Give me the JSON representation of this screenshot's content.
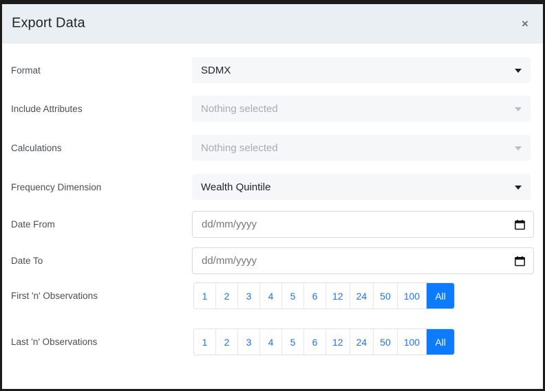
{
  "modal": {
    "title": "Export Data",
    "close_label": "×",
    "close_icon": "close-icon"
  },
  "theme": {
    "accent": "#0d7bfd",
    "link": "#1a73ff",
    "header_bg": "#eaeff3",
    "field_bg": "#f6f7f9",
    "label_color": "#4a4f54",
    "placeholder_color": "#a7acb1",
    "border_color": "#d5d9dd",
    "frame_color": "#1b1b1b"
  },
  "form": {
    "format": {
      "label": "Format",
      "value": "SDMX",
      "disabled": false,
      "caret_icon": "chevron-down-icon"
    },
    "include_attributes": {
      "label": "Include Attributes",
      "value": "Nothing selected",
      "disabled": true,
      "caret_icon": "chevron-down-icon"
    },
    "calculations": {
      "label": "Calculations",
      "value": "Nothing selected",
      "disabled": true,
      "caret_icon": "chevron-down-icon"
    },
    "frequency_dimension": {
      "label": "Frequency Dimension",
      "value": "Wealth Quintile",
      "disabled": false,
      "caret_icon": "chevron-down-icon"
    },
    "date_from": {
      "label": "Date From",
      "value": "",
      "placeholder": "dd/mm/yyyy",
      "icon": "calendar-icon"
    },
    "date_to": {
      "label": "Date To",
      "value": "",
      "placeholder": "dd/mm/yyyy",
      "icon": "calendar-icon"
    },
    "first_n_observations": {
      "label": "First 'n' Observations",
      "options": [
        "1",
        "2",
        "3",
        "4",
        "5",
        "6",
        "12",
        "24",
        "50",
        "100",
        "All"
      ],
      "selected": "All"
    },
    "last_n_observations": {
      "label": "Last 'n' Observations",
      "options": [
        "1",
        "2",
        "3",
        "4",
        "5",
        "6",
        "12",
        "24",
        "50",
        "100",
        "All"
      ],
      "selected": "All"
    }
  }
}
